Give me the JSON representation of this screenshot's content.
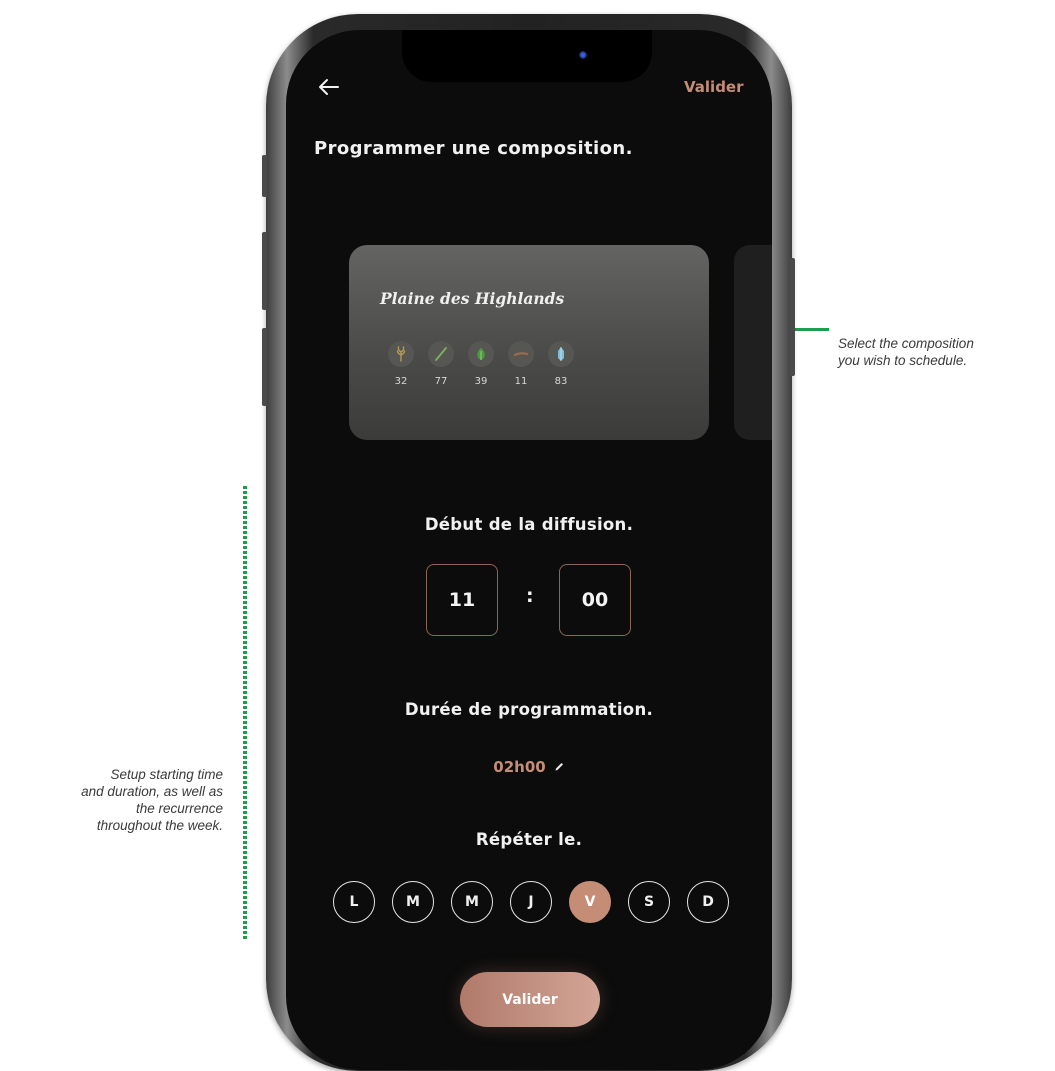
{
  "annotations": {
    "right": [
      "Select the composition",
      "you wish to schedule."
    ],
    "left": [
      "Setup starting time",
      "and duration, as well as",
      "the recurrence",
      "throughout the week."
    ]
  },
  "header": {
    "back_icon": "arrow-left-icon",
    "validate_label": "Valider"
  },
  "page": {
    "title": "Programmer une composition."
  },
  "composition_card": {
    "title": "Plaine des Highlands",
    "ingredients": [
      {
        "icon": "wheat-icon",
        "value": "32"
      },
      {
        "icon": "leaf-icon",
        "value": "77"
      },
      {
        "icon": "herb-icon",
        "value": "39"
      },
      {
        "icon": "wood-icon",
        "value": "11"
      },
      {
        "icon": "crystal-icon",
        "value": "83"
      }
    ]
  },
  "start": {
    "label": "Début de la diffusion.",
    "hours": "11",
    "separator": ":",
    "minutes": "00"
  },
  "duration": {
    "label": "Durée de programmation.",
    "value": "02h00",
    "edit_icon": "pencil-icon"
  },
  "repeat": {
    "label": "Répéter le.",
    "days": [
      {
        "label": "L",
        "active": false
      },
      {
        "label": "M",
        "active": false
      },
      {
        "label": "M",
        "active": false
      },
      {
        "label": "J",
        "active": false
      },
      {
        "label": "V",
        "active": true
      },
      {
        "label": "S",
        "active": false
      },
      {
        "label": "D",
        "active": false
      }
    ]
  },
  "footer": {
    "validate_label": "Valider"
  },
  "colors": {
    "accent": "#c58c76",
    "background": "#0c0c0c",
    "annotation_green": "#1f9c4c"
  }
}
